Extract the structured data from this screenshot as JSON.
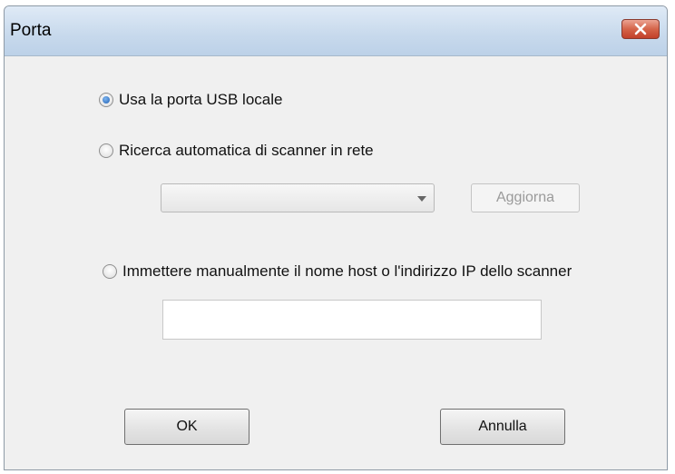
{
  "window": {
    "title": "Porta"
  },
  "options": {
    "usb_label": "Usa la porta USB locale",
    "network_label": "Ricerca automatica di scanner in rete",
    "manual_label": "Immettere manualmente il nome host o l'indirizzo IP dello scanner",
    "selected": "usb"
  },
  "network": {
    "scanner_select_value": "",
    "refresh_label": "Aggiorna"
  },
  "manual": {
    "host_input_value": ""
  },
  "footer": {
    "ok_label": "OK",
    "cancel_label": "Annulla"
  },
  "icons": {
    "close": "close-icon",
    "dropdown": "chevron-down-icon"
  },
  "colors": {
    "close_button": "#d56449",
    "radio_selected": "#1e5fb3",
    "disabled_text": "#9a9a9a"
  }
}
